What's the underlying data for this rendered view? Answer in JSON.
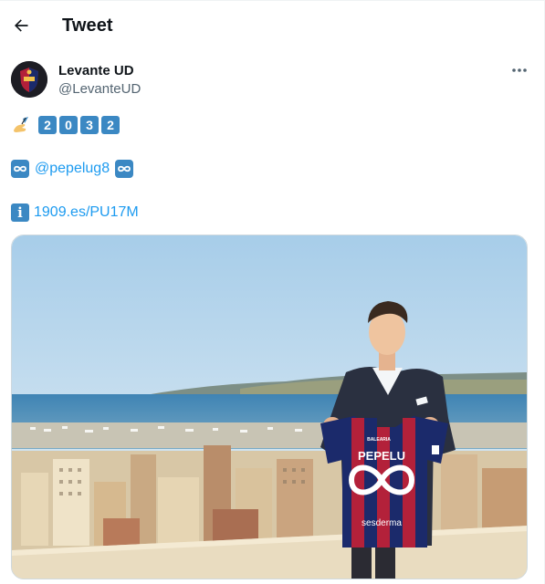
{
  "header": {
    "title": "Tweet",
    "back_icon": "arrow-left-icon"
  },
  "author": {
    "display_name": "Levante UD",
    "handle": "@LevanteUD",
    "more_icon": "more-horizontal-icon"
  },
  "tweet": {
    "line1": {
      "emoji": "writing-hand-emoji",
      "digits": [
        "2",
        "0",
        "3",
        "2"
      ]
    },
    "line2": {
      "emoji": "infinity-emoji",
      "mention": "@pepelug8"
    },
    "line3": {
      "emoji": "information-emoji",
      "link": "1909.es/PU17M"
    }
  },
  "media": {
    "shirt_name": "PEPELU",
    "shirt_sponsor": "sesderma",
    "shirt_top": "BALEARIA"
  },
  "colors": {
    "accent": "#1d9bf0",
    "keycap": "#3b88c3",
    "text_secondary": "#536471",
    "levante_blue": "#1b2a6b",
    "levante_red": "#b3213a"
  }
}
